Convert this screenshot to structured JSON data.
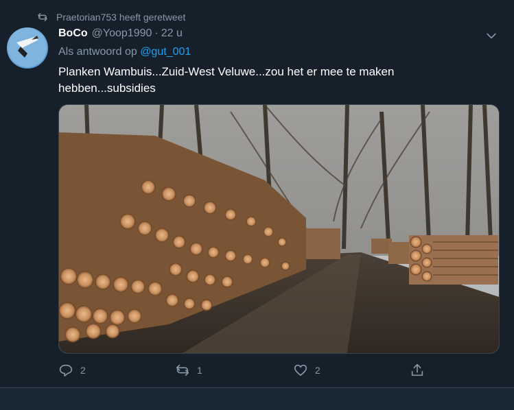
{
  "retweet": {
    "text": "Praetorian753 heeft geretweet",
    "icon": "retweet-icon"
  },
  "author": {
    "name": "BoCo",
    "handle": "@Yoop1990",
    "separator": "·",
    "time": "22 u"
  },
  "reply": {
    "prefix": "Als antwoord op",
    "mention": "@gut_001"
  },
  "tweet_text": "Planken Wambuis...Zuid-West Veluwe...zou het er mee te maken hebben...subsidies",
  "actions": {
    "reply_count": "2",
    "retweet_count": "1",
    "like_count": "2"
  },
  "colors": {
    "background": "#15202b",
    "secondary_text": "#8899a6",
    "link": "#1da1f2"
  }
}
